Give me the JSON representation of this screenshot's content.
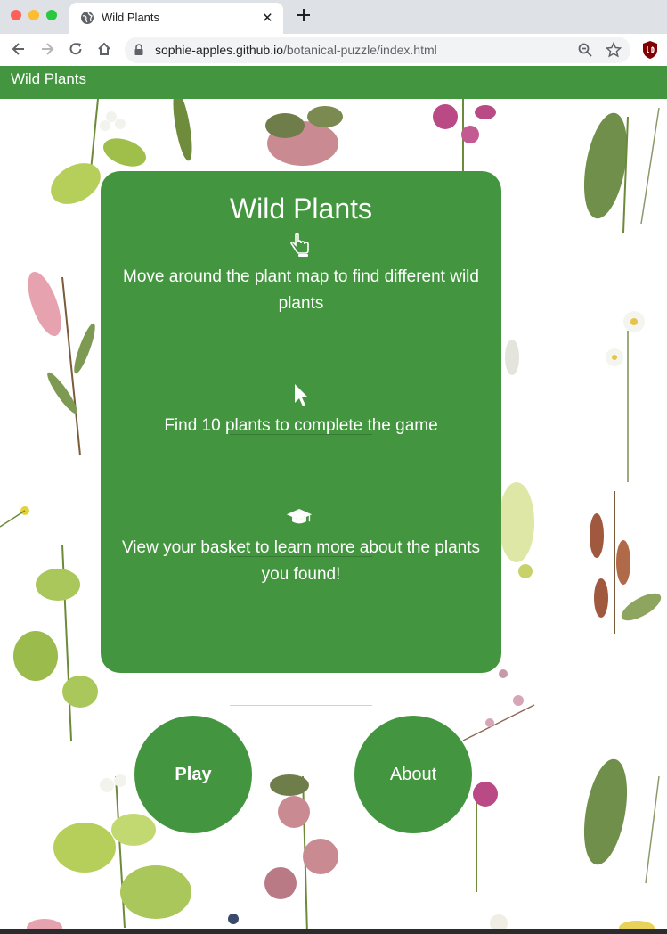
{
  "browser": {
    "tab_title": "Wild Plants",
    "tab_close": "✕",
    "url_host": "sophie-apples.github.io",
    "url_path": "/botanical-puzzle/index.html"
  },
  "navbar": {
    "brand": "Wild Plants"
  },
  "card": {
    "title": "Wild Plants",
    "instructions": [
      {
        "icon": "pointing-hand-icon",
        "text": "Move around the plant map to find different wild plants"
      },
      {
        "icon": "cursor-arrow-icon",
        "text": "Find 10 plants to complete the game"
      },
      {
        "icon": "graduation-cap-icon",
        "text": "View your basket to learn more about the plants you found!"
      }
    ]
  },
  "buttons": {
    "play": "Play",
    "about": "About"
  },
  "colors": {
    "primary_green": "#43963f",
    "text_on_green": "#ffffff"
  }
}
